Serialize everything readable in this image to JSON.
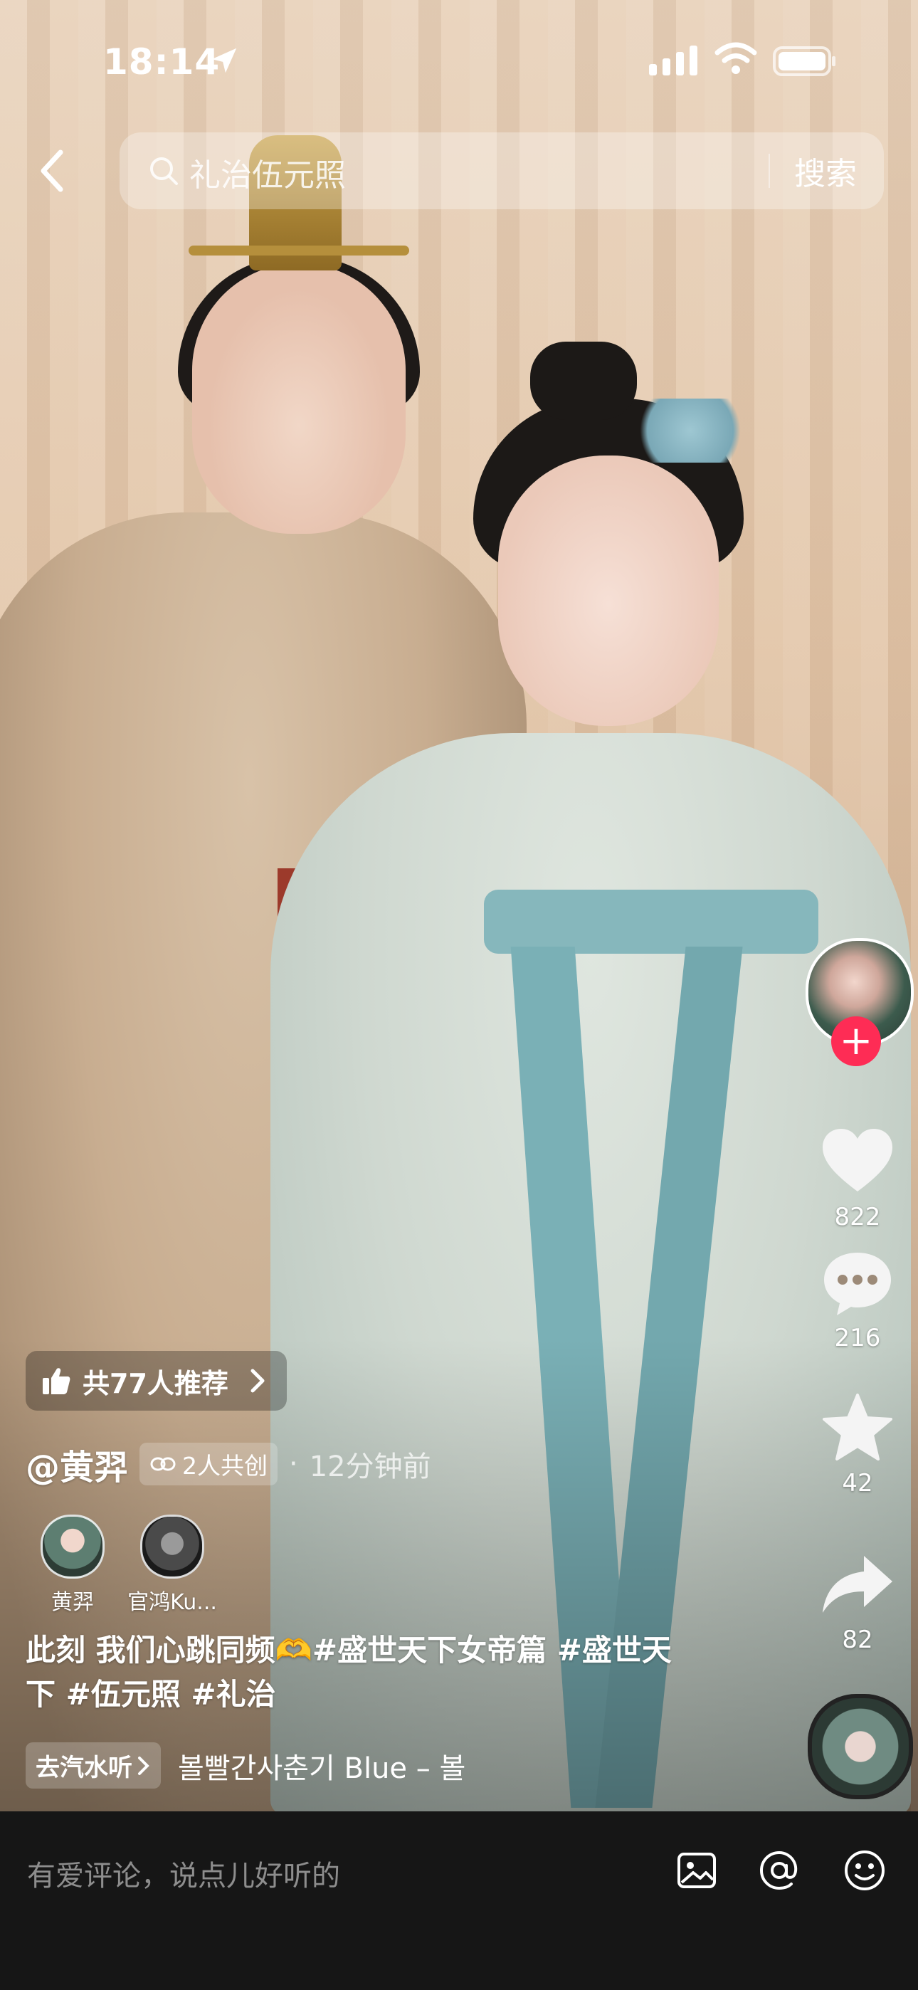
{
  "status_bar": {
    "time": "18:14"
  },
  "search": {
    "query": "礼治伍元照",
    "button_label": "搜索"
  },
  "rail": {
    "likes": "822",
    "comments": "216",
    "favorites": "42",
    "shares": "82",
    "follow_symbol": "+"
  },
  "video": {
    "recommend_label": "共77人推荐",
    "author": "@黄羿",
    "coop_label": "2人共创",
    "time_ago": "12分钟前",
    "creators": [
      {
        "name": "黄羿"
      },
      {
        "name": "官鸿Ku..."
      }
    ],
    "caption_line1": "此刻 我们心跳同频",
    "caption_emoji": "🫶",
    "caption_tags1": "#盛世天下女帝篇 #盛世天",
    "caption_line2": "下 #伍元照 #礼治",
    "listen_label": "去汽水听",
    "song": "볼빨간사춘기    Blue – 볼"
  },
  "comment_bar": {
    "placeholder": "有爱评论，说点儿好听的"
  },
  "colors": {
    "follow_red": "#fe2c55",
    "comment_bar_bg": "#161616"
  },
  "icons": [
    "back-icon",
    "search-icon",
    "heart-icon",
    "comment-icon",
    "star-icon",
    "share-icon",
    "thumb-up-icon",
    "image-icon",
    "at-icon",
    "emoji-icon",
    "signal-icon",
    "wifi-icon",
    "battery-icon",
    "location-arrow-icon"
  ]
}
